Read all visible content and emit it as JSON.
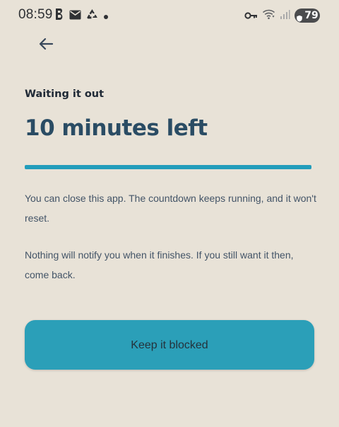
{
  "status_bar": {
    "time": "08:59",
    "battery": "79",
    "left_icons": [
      "b-app-icon",
      "mail-icon",
      "recycle-icon",
      "dot-icon"
    ],
    "right_icons": [
      "key-icon",
      "wifi-icon",
      "signal-icon",
      "battery-icon"
    ]
  },
  "screen": {
    "back_icon": "back-arrow-icon",
    "subtitle": "Waiting it out",
    "headline": "10 minutes left",
    "progress_percent": 100,
    "paragraphs": [
      "You can close this app. The countdown keeps running, and it won't reset.",
      "Nothing will notify you when it finishes. If you still want it then, come back."
    ],
    "primary_button": "Keep it blocked"
  },
  "colors": {
    "background": "#e8e2d7",
    "accent": "#229dbb",
    "button": "#2b9fb8",
    "headline": "#2a4c64",
    "text": "#435467"
  }
}
